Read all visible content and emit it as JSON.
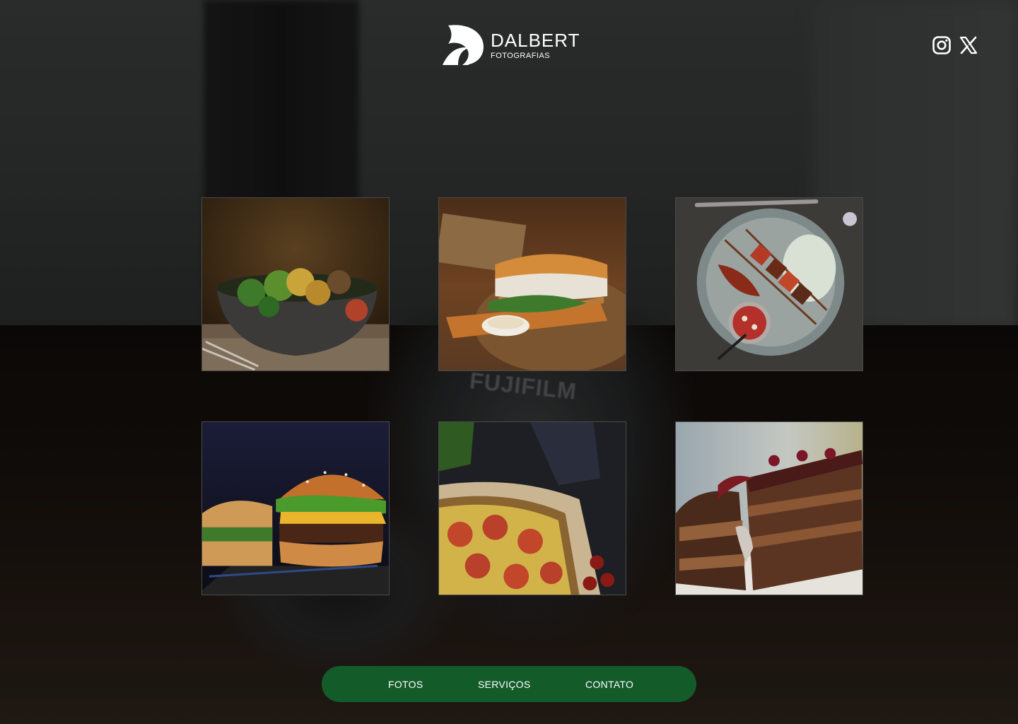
{
  "header": {
    "brand_name": "DALBERT",
    "brand_subtitle": "FOTOGRAFIAS",
    "social": [
      {
        "name": "instagram-icon"
      },
      {
        "name": "x-icon"
      }
    ]
  },
  "background": {
    "brand_text": "FUJIFILM"
  },
  "gallery": {
    "photos": [
      {
        "name": "photo-salad-bowl",
        "icon": "salad-photo"
      },
      {
        "name": "photo-sandwich",
        "icon": "sandwich-photo"
      },
      {
        "name": "photo-skewers",
        "icon": "skewer-plate-photo"
      },
      {
        "name": "photo-burger",
        "icon": "burger-photo"
      },
      {
        "name": "photo-quiche",
        "icon": "quiche-photo"
      },
      {
        "name": "photo-chocolate-cake",
        "icon": "cake-photo"
      }
    ]
  },
  "nav": {
    "items": [
      {
        "label": "FOTOS"
      },
      {
        "label": "SERVIÇOS"
      },
      {
        "label": "CONTATO"
      }
    ],
    "color": "#135c2a"
  }
}
